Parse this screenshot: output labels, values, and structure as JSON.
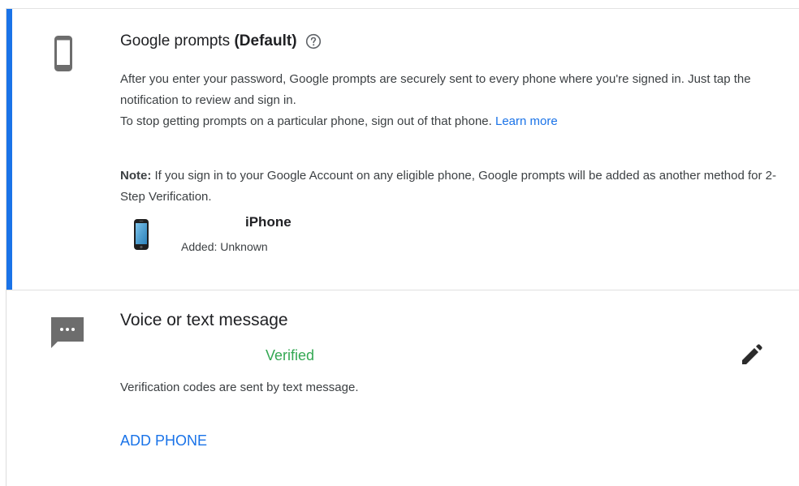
{
  "google_prompts": {
    "title": "Google prompts",
    "title_suffix": "(Default)",
    "icon": "smartphone-icon",
    "help_icon": "help-circle-icon",
    "description_line1": "After you enter your password, Google prompts are securely sent to every phone where you're signed in. Just tap the notification to review and sign in.",
    "description_line2": "To stop getting prompts on a particular phone, sign out of that phone.",
    "learn_more": "Learn more",
    "note_label": "Note:",
    "note_text": "If you sign in to your Google Account on any eligible phone, Google prompts will be added as another method for 2-Step Verification.",
    "device": {
      "icon": "iphone-icon",
      "name": "iPhone",
      "added": "Added: Unknown"
    },
    "accent_color": "#1a73e8"
  },
  "voice_text": {
    "icon": "sms-icon",
    "title": "Voice or text message",
    "status": "Verified",
    "status_color": "#34a853",
    "edit_icon": "pencil-icon",
    "description": "Verification codes are sent by text message.",
    "add_phone_label": "ADD PHONE"
  }
}
